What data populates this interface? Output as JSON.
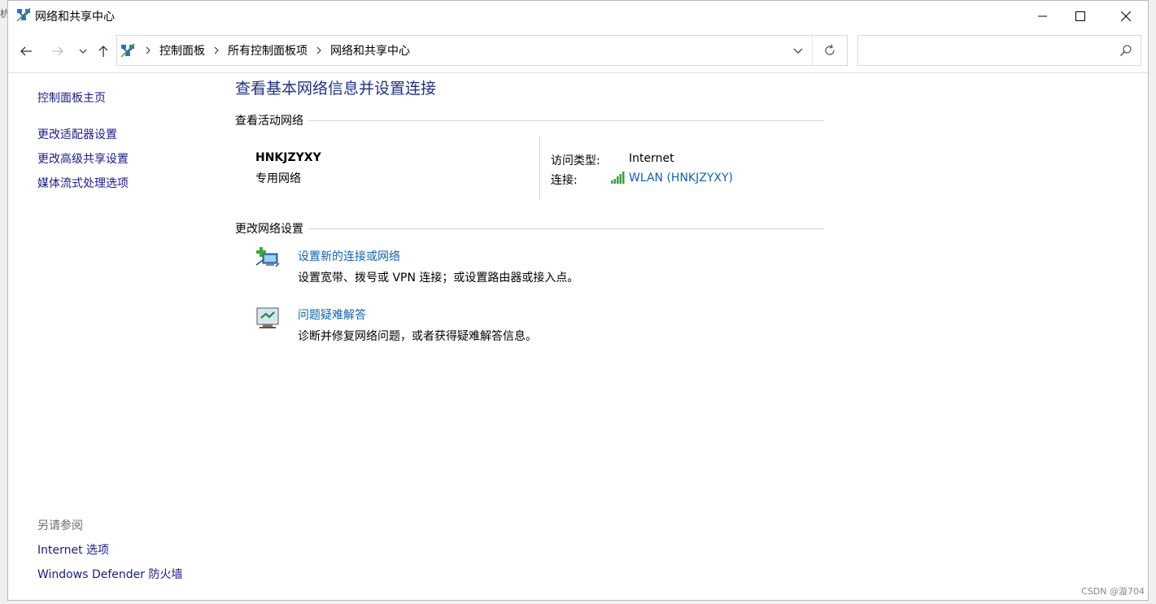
{
  "window": {
    "title": "网络和共享中心"
  },
  "navigation": {
    "breadcrumbs": [
      "控制面板",
      "所有控制面板项",
      "网络和共享中心"
    ],
    "search_placeholder": ""
  },
  "sidebar": {
    "home": "控制面板主页",
    "links": [
      "更改适配器设置",
      "更改高级共享设置",
      "媒体流式处理选项"
    ],
    "see_also_title": "另请参阅",
    "see_also": [
      "Internet 选项",
      "Windows Defender 防火墙"
    ]
  },
  "main": {
    "title": "查看基本网络信息并设置连接",
    "active_section": "查看活动网络",
    "network_name": "HNKJZYXY",
    "network_category": "专用网络",
    "access_type_label": "访问类型:",
    "access_type_value": "Internet",
    "connection_label": "连接:",
    "connection_value": "WLAN (HNKJZYXY)",
    "change_section": "更改网络设置",
    "tasks": [
      {
        "link": "设置新的连接或网络",
        "desc": "设置宽带、拨号或 VPN 连接；或设置路由器或接入点。"
      },
      {
        "link": "问题疑难解答",
        "desc": "诊断并修复网络问题，或者获得疑难解答信息。"
      }
    ]
  },
  "watermark": "CSDN @漩704",
  "edge_text": "杭",
  "colors": {
    "link": "#0e63b6",
    "title": "#1e3287",
    "sidebar_link": "#1a1a8f"
  }
}
